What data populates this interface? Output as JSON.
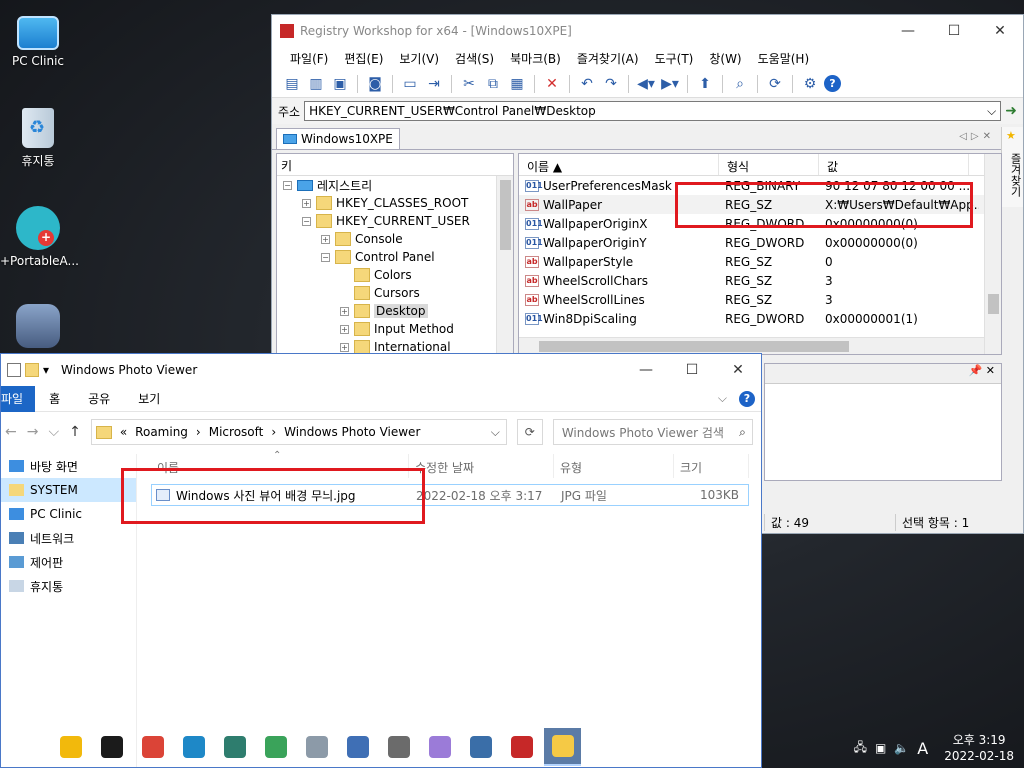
{
  "desktop": {
    "icons": [
      {
        "label": "PC Clinic"
      },
      {
        "label": "휴지통"
      },
      {
        "label": "+PortableA..."
      },
      {
        "label": ""
      }
    ]
  },
  "registry": {
    "title": "Registry Workshop for x64 - [Windows10XPE]",
    "menu": [
      "파일(F)",
      "편집(E)",
      "보기(V)",
      "검색(S)",
      "북마크(B)",
      "즐겨찾기(A)",
      "도구(T)",
      "창(W)",
      "도움말(H)"
    ],
    "address_label": "주소",
    "address_value": "HKEY_CURRENT_USER₩Control Panel₩Desktop",
    "tab_label": "Windows10XPE",
    "favorites_rail": "즐겨찾기",
    "tree_header": "키",
    "tree": [
      {
        "label": "레지스트리",
        "indent": 0,
        "exp": "−",
        "kind": "pc"
      },
      {
        "label": "HKEY_CLASSES_ROOT",
        "indent": 1,
        "exp": "+",
        "kind": "folder"
      },
      {
        "label": "HKEY_CURRENT_USER",
        "indent": 1,
        "exp": "−",
        "kind": "folder"
      },
      {
        "label": "Console",
        "indent": 2,
        "exp": "+",
        "kind": "folder"
      },
      {
        "label": "Control Panel",
        "indent": 2,
        "exp": "−",
        "kind": "folder"
      },
      {
        "label": "Colors",
        "indent": 3,
        "exp": "",
        "kind": "folder"
      },
      {
        "label": "Cursors",
        "indent": 3,
        "exp": "",
        "kind": "folder"
      },
      {
        "label": "Desktop",
        "indent": 3,
        "exp": "+",
        "kind": "folder",
        "selected": true
      },
      {
        "label": "Input Method",
        "indent": 3,
        "exp": "+",
        "kind": "folder"
      },
      {
        "label": "International",
        "indent": 3,
        "exp": "+",
        "kind": "folder"
      }
    ],
    "list_headers": {
      "name": "이름",
      "type": "형식",
      "value": "값"
    },
    "values": [
      {
        "name": "UserPreferencesMask",
        "type": "REG_BINARY",
        "data": "90 12 07 80 12 00 00 ...",
        "kind": "bin"
      },
      {
        "name": "WallPaper",
        "type": "REG_SZ",
        "data": "X:₩Users₩Default₩App...",
        "kind": "ab",
        "selected": true
      },
      {
        "name": "WallpaperOriginX",
        "type": "REG_DWORD",
        "data": "0x00000000(0)",
        "kind": "bin"
      },
      {
        "name": "WallpaperOriginY",
        "type": "REG_DWORD",
        "data": "0x00000000(0)",
        "kind": "bin"
      },
      {
        "name": "WallpaperStyle",
        "type": "REG_SZ",
        "data": "0",
        "kind": "ab"
      },
      {
        "name": "WheelScrollChars",
        "type": "REG_SZ",
        "data": "3",
        "kind": "ab"
      },
      {
        "name": "WheelScrollLines",
        "type": "REG_SZ",
        "data": "3",
        "kind": "ab"
      },
      {
        "name": "Win8DpiScaling",
        "type": "REG_DWORD",
        "data": "0x00000001(1)",
        "kind": "bin"
      }
    ],
    "status": {
      "values": "값 : 49",
      "selected": "선택 항목 : 1"
    }
  },
  "explorer": {
    "title": "Windows Photo Viewer",
    "ribbon": {
      "file": "파일",
      "home": "홈",
      "share": "공유",
      "view": "보기"
    },
    "breadcrumb": [
      "Roaming",
      "Microsoft",
      "Windows Photo Viewer"
    ],
    "breadcrumb_prefix": "«",
    "search_placeholder": "Windows Photo Viewer 검색",
    "nav": [
      {
        "label": "바탕 화면",
        "color": "#3d8ee0"
      },
      {
        "label": "SYSTEM",
        "color": "#f5d77a",
        "selected": true
      },
      {
        "label": "PC Clinic",
        "color": "#3d8ee0"
      },
      {
        "label": "네트워크",
        "color": "#4a7fb5"
      },
      {
        "label": "제어판",
        "color": "#5a9bd4"
      },
      {
        "label": "휴지통",
        "color": "#c8d6e5"
      }
    ],
    "columns": {
      "name": "이름",
      "date": "수정한 날짜",
      "type": "유형",
      "size": "크기"
    },
    "files": [
      {
        "name": "Windows 사진 뷰어 배경 무늬.jpg",
        "date": "2022-02-18 오후 3:17",
        "type": "JPG 파일",
        "size": "103KB"
      }
    ]
  },
  "taskbar": {
    "apps": [
      {
        "name": "file-manager",
        "color": "#f2b90c"
      },
      {
        "name": "terminal",
        "color": "#1b1b1b"
      },
      {
        "name": "chrome",
        "color": "#db4437"
      },
      {
        "name": "edge",
        "color": "#1e88c7"
      },
      {
        "name": "edge-dev",
        "color": "#2e7d6e"
      },
      {
        "name": "app-red-green",
        "color": "#3aa35a"
      },
      {
        "name": "scanner",
        "color": "#8c9aa8"
      },
      {
        "name": "network-tool",
        "color": "#3f6fb5"
      },
      {
        "name": "disk-tool",
        "color": "#6b6b6b"
      },
      {
        "name": "dvd",
        "color": "#9b7bd8"
      },
      {
        "name": "virtualbox",
        "color": "#3a6ea8"
      },
      {
        "name": "registry-tool",
        "color": "#c62828"
      },
      {
        "name": "explorer",
        "color": "#f5c945",
        "active": true
      }
    ],
    "ime": "A",
    "time": "오후 3:19",
    "date": "2022-02-18"
  },
  "colors": {
    "highlight": "#e0191f",
    "accent": "#1c66c6"
  }
}
